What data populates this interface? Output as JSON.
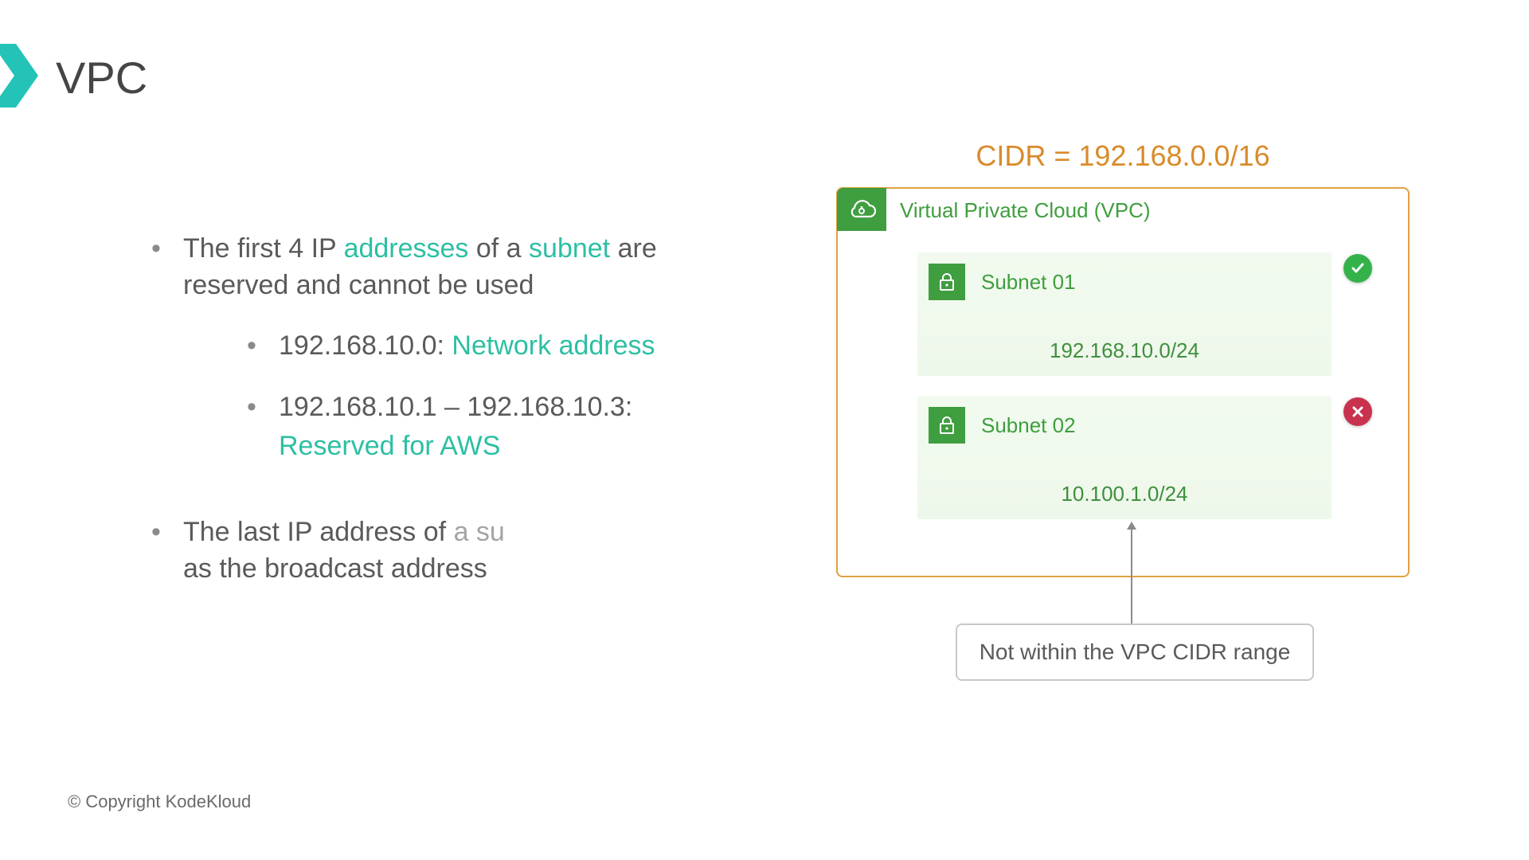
{
  "title": "VPC",
  "bullets": {
    "b1_pre": "The first 4 IP ",
    "b1_hl1": "addresses",
    "b1_mid": " of a ",
    "b1_hl2": "subnet",
    "b1_post": " are reserved and cannot be used",
    "s1_pre": "192.168.10.0: ",
    "s1_hl": "Network address",
    "s2_pre": "192.168.10.1 – 192.168.10.3: ",
    "s2_hl": "Reserved for AWS",
    "b2_a": "The last IP address of ",
    "b2_b": "a su",
    "b2_c": "as the broadcast address"
  },
  "diagram": {
    "cidr": "CIDR = 192.168.0.0/16",
    "vpc_label": "Virtual Private Cloud (VPC)",
    "subnet1_name": "Subnet 01",
    "subnet1_ip": "192.168.10.0/24",
    "subnet2_name": "Subnet 02",
    "subnet2_ip": "10.100.1.0/24",
    "note": "Not within the VPC CIDR range"
  },
  "copyright": "© Copyright KodeKloud"
}
